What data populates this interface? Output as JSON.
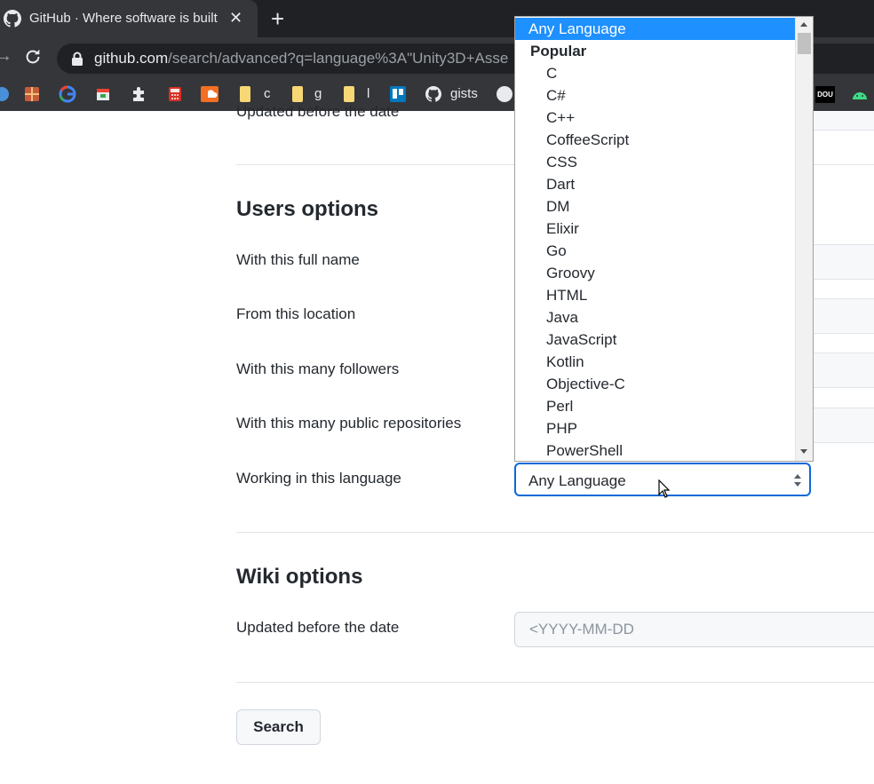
{
  "browser": {
    "tab_title": "GitHub · Where software is built",
    "tab_close": "✕",
    "new_tab": "+",
    "url_host": "github.com",
    "url_path": "/search/advanced?q=language%3A\"Unity3D+Asse",
    "bookmarks": [
      {
        "icon": "folder-icon",
        "label": "c"
      },
      {
        "icon": "folder-icon",
        "label": "g"
      },
      {
        "icon": "folder-icon",
        "label": "l"
      },
      {
        "icon": "github-icon",
        "label": "gists"
      }
    ],
    "dou_badge": "DOU"
  },
  "page": {
    "clipped_label": "Updated before the date",
    "users_options": {
      "title": "Users options",
      "rows": [
        "With this full name",
        "From this location",
        "With this many followers",
        "With this many public repositories",
        "Working in this language"
      ],
      "language_select_value": "Any Language"
    },
    "wiki_options": {
      "title": "Wiki options",
      "date_label": "Updated before the date",
      "date_placeholder": "<YYYY-MM-DD"
    },
    "search_button": "Search"
  },
  "dropdown": {
    "selected": "Any Language",
    "group": "Popular",
    "options": [
      "C",
      "C#",
      "C++",
      "CoffeeScript",
      "CSS",
      "Dart",
      "DM",
      "Elixir",
      "Go",
      "Groovy",
      "HTML",
      "Java",
      "JavaScript",
      "Kotlin",
      "Objective-C",
      "Perl",
      "PHP",
      "PowerShell"
    ]
  },
  "colors": {
    "selected_option_bg": "#1e90ff",
    "focus_border": "#0969da",
    "chrome_dark": "#35363a"
  }
}
